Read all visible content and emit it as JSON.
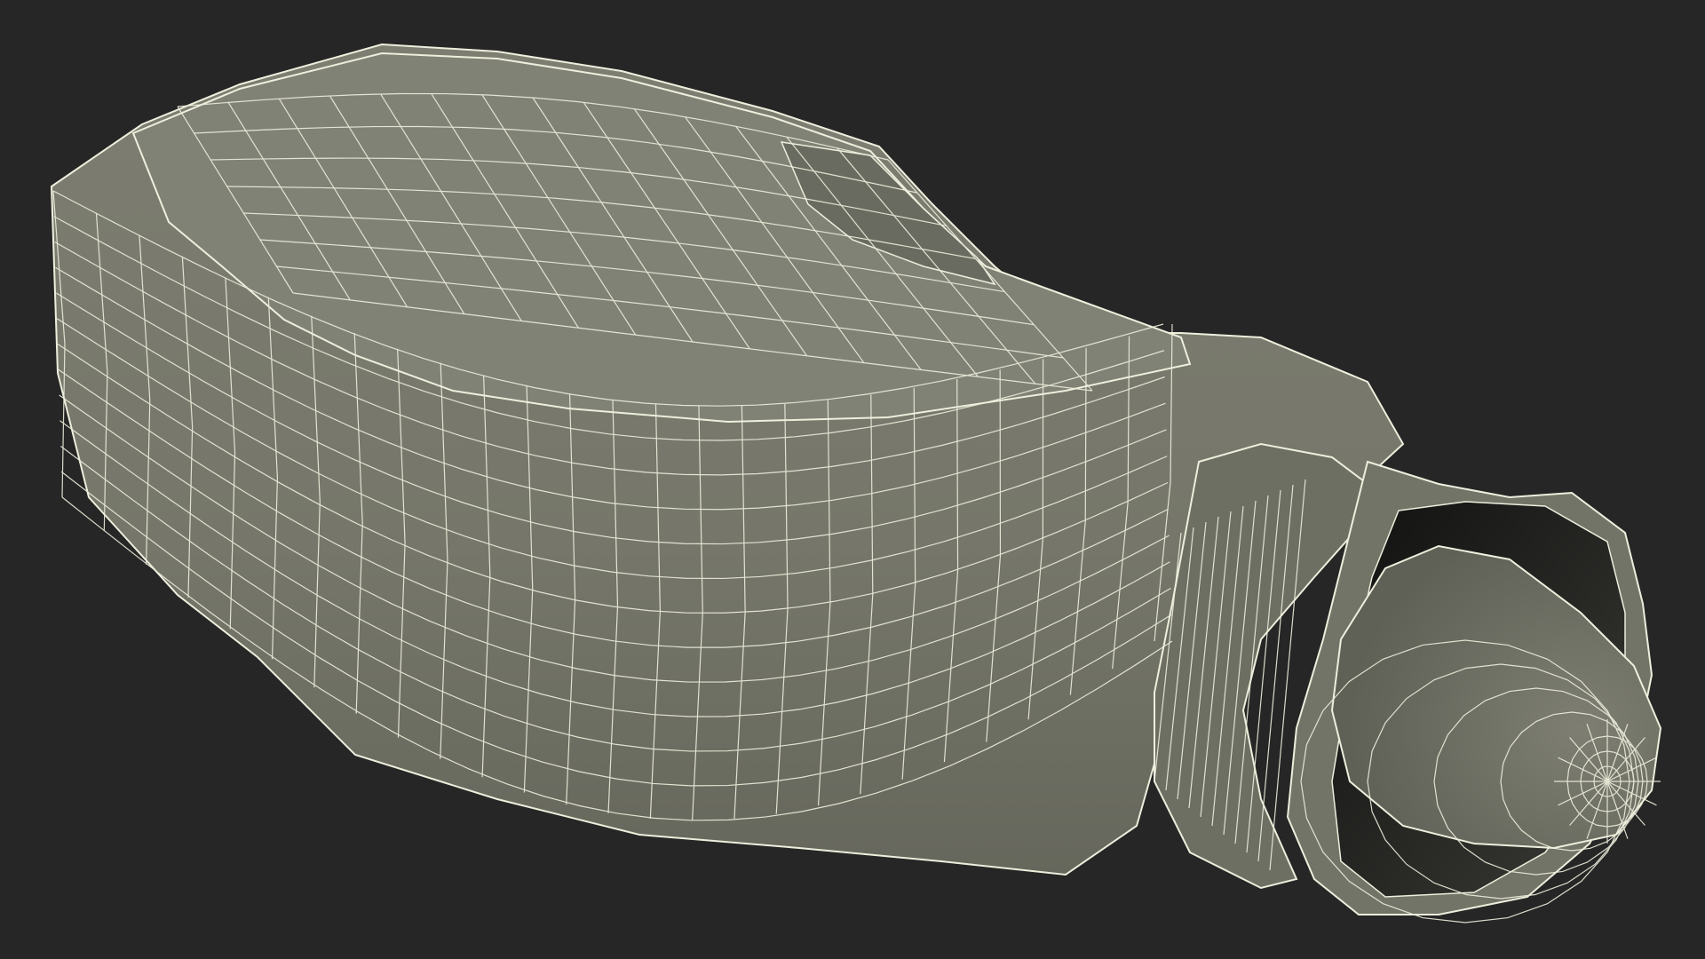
{
  "scene": {
    "subject": "wireframe-3d-model",
    "background_color": "#262626",
    "surface_color": "#797a6d",
    "surface_shadow_color": "#5c5d53",
    "wire_color": "#eeeedd",
    "interior_color": "#1f201d",
    "view": "perspective",
    "render_mode": "shaded-wireframe"
  }
}
